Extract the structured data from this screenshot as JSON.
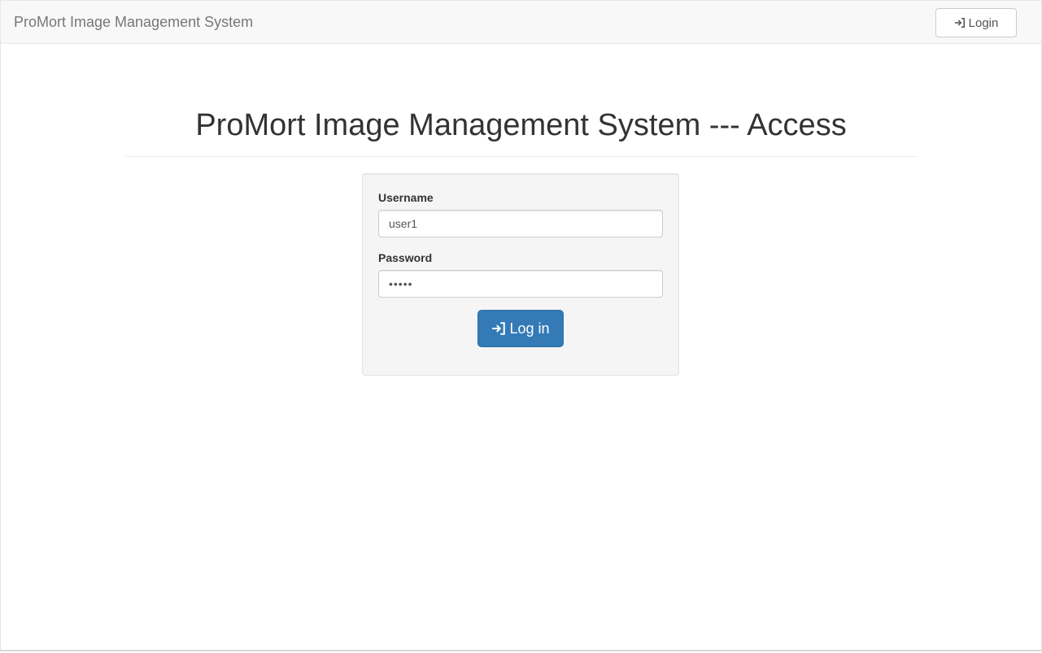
{
  "navbar": {
    "brand": "ProMort Image Management System",
    "login_button_label": "Login",
    "login_icon": "log-in-icon"
  },
  "main": {
    "title": "ProMort Image Management System --- Access"
  },
  "form": {
    "username_label": "Username",
    "username_value": "user1",
    "password_label": "Password",
    "password_value": "•••••",
    "submit_label": "Log in",
    "submit_icon": "log-in-icon"
  },
  "colors": {
    "primary": "#337ab7",
    "navbar_bg": "#f8f8f8",
    "well_bg": "#f5f5f5"
  }
}
